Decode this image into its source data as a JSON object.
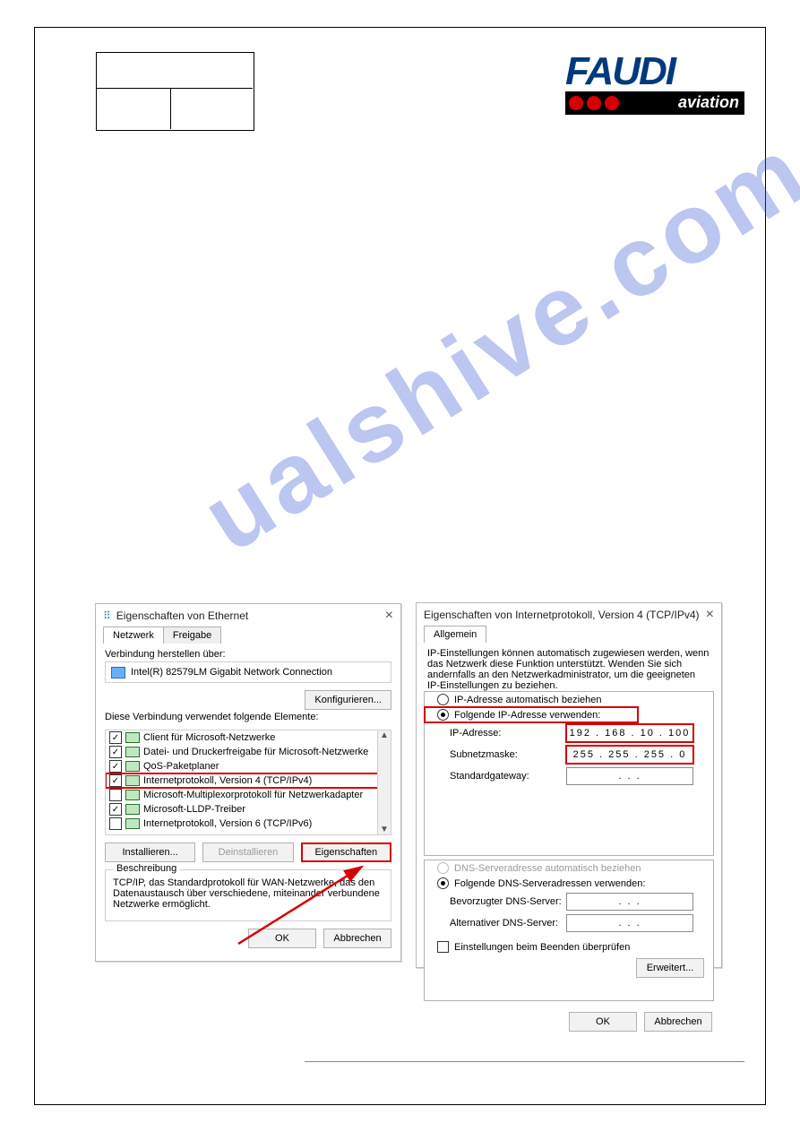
{
  "logo": {
    "name": "FAUDI",
    "sub": "aviation"
  },
  "watermark": "ualshive.com",
  "dlg1": {
    "title": "Eigenschaften von Ethernet",
    "tabs": {
      "active": "Netzwerk",
      "other": "Freigabe"
    },
    "connLabel": "Verbindung herstellen über:",
    "adapter": "Intel(R) 82579LM Gigabit Network Connection",
    "configureBtn": "Konfigurieren...",
    "listLabel": "Diese Verbindung verwendet folgende Elemente:",
    "items": [
      {
        "checked": true,
        "label": "Client für Microsoft-Netzwerke"
      },
      {
        "checked": true,
        "label": "Datei- und Druckerfreigabe für Microsoft-Netzwerke"
      },
      {
        "checked": true,
        "label": "QoS-Paketplaner"
      },
      {
        "checked": true,
        "label": "Internetprotokoll, Version 4 (TCP/IPv4)",
        "hl": true
      },
      {
        "checked": false,
        "label": "Microsoft-Multiplexorprotokoll für Netzwerkadapter"
      },
      {
        "checked": true,
        "label": "Microsoft-LLDP-Treiber"
      },
      {
        "checked": false,
        "label": "Internetprotokoll, Version 6 (TCP/IPv6)"
      }
    ],
    "installBtn": "Installieren...",
    "uninstallBtn": "Deinstallieren",
    "propsBtn": "Eigenschaften",
    "descTitle": "Beschreibung",
    "descText": "TCP/IP, das Standardprotokoll für WAN-Netzwerke, das den Datenaustausch über verschiedene, miteinander verbundene Netzwerke ermöglicht.",
    "ok": "OK",
    "cancel": "Abbrechen"
  },
  "dlg2": {
    "title": "Eigenschaften von Internetprotokoll, Version 4 (TCP/IPv4)",
    "tab": "Allgemein",
    "note": "IP-Einstellungen können automatisch zugewiesen werden, wenn das Netzwerk diese Funktion unterstützt. Wenden Sie sich andernfalls an den Netzwerkadministrator, um die geeigneten IP-Einstellungen zu beziehen.",
    "radioAuto": "IP-Adresse automatisch beziehen",
    "radioManual": "Folgende IP-Adresse verwenden:",
    "ipLabel": "IP-Adresse:",
    "ip": "192 . 168 .  10 . 100",
    "maskLabel": "Subnetzmaske:",
    "mask": "255 . 255 . 255 .   0",
    "gwLabel": "Standardgateway:",
    "gw": ".       .       .",
    "dnsAuto": "DNS-Serveradresse automatisch beziehen",
    "dnsManual": "Folgende DNS-Serveradressen verwenden:",
    "dns1Label": "Bevorzugter DNS-Server:",
    "dns1": ".       .       .",
    "dns2Label": "Alternativer DNS-Server:",
    "dns2": ".       .       .",
    "validate": "Einstellungen beim Beenden überprüfen",
    "advanced": "Erweitert...",
    "ok": "OK",
    "cancel": "Abbrechen"
  }
}
